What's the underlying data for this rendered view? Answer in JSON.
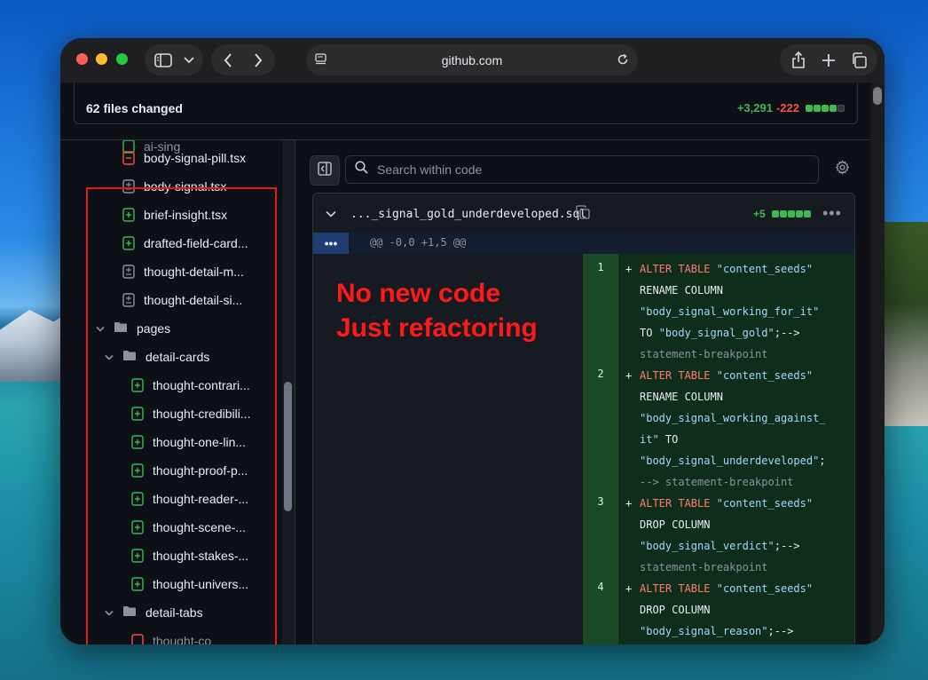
{
  "browser": {
    "url": "github.com"
  },
  "header": {
    "files_changed": "62 files changed",
    "additions": "+3,291",
    "deletions": "-222"
  },
  "tree": {
    "partial_top": "ai-sing",
    "items": [
      {
        "label": "body-signal-pill.tsx",
        "type": "file",
        "status": "removed"
      },
      {
        "label": "body-signal.tsx",
        "type": "file",
        "status": "modified"
      },
      {
        "label": "brief-insight.tsx",
        "type": "file",
        "status": "added"
      },
      {
        "label": "drafted-field-card...",
        "type": "file",
        "status": "added"
      },
      {
        "label": "thought-detail-m...",
        "type": "file",
        "status": "modified"
      },
      {
        "label": "thought-detail-si...",
        "type": "file",
        "status": "modified"
      },
      {
        "label": "pages",
        "type": "folder"
      },
      {
        "label": "detail-cards",
        "type": "folder"
      },
      {
        "label": "thought-contrari...",
        "type": "file",
        "status": "added"
      },
      {
        "label": "thought-credibili...",
        "type": "file",
        "status": "added"
      },
      {
        "label": "thought-one-lin...",
        "type": "file",
        "status": "added"
      },
      {
        "label": "thought-proof-p...",
        "type": "file",
        "status": "added"
      },
      {
        "label": "thought-reader-...",
        "type": "file",
        "status": "added"
      },
      {
        "label": "thought-scene-...",
        "type": "file",
        "status": "added"
      },
      {
        "label": "thought-stakes-...",
        "type": "file",
        "status": "added"
      },
      {
        "label": "thought-univers...",
        "type": "file",
        "status": "added"
      },
      {
        "label": "detail-tabs",
        "type": "folder"
      }
    ],
    "partial_bottom": "thought-co"
  },
  "search": {
    "placeholder": "Search within code"
  },
  "diff": {
    "filename": "..._signal_gold_underdeveloped.sql",
    "additions": "+5",
    "hunk_expand": "•••",
    "hunk_header": "@@ -0,0 +1,5 @@",
    "annotation_line1": "No new code",
    "annotation_line2": "Just refactoring",
    "lines": [
      {
        "num": "1",
        "sign": "+"
      },
      {
        "num": "2",
        "sign": "+"
      },
      {
        "num": "3",
        "sign": "+"
      },
      {
        "num": "4",
        "sign": "+"
      }
    ],
    "code": {
      "l1_kw": "ALTER TABLE",
      "l1_tbl": "\"content_seeds\"",
      "l1_rename": "RENAME COLUMN",
      "l1_old": "\"body_signal_working_for_it\"",
      "l1_to": "TO",
      "l1_new": "\"body_signal_gold\"",
      "l1_tail": ";-->",
      "l1_bp": "statement-breakpoint",
      "l2_kw": "ALTER TABLE",
      "l2_tbl": "\"content_seeds\"",
      "l2_rename": "RENAME COLUMN",
      "l2_old_a": "\"body_signal_working_against_",
      "l2_old_b": "it\"",
      "l2_to": "TO",
      "l2_new": "\"body_signal_underdeveloped\"",
      "l2_tail": ";",
      "l2_bp": "--> statement-breakpoint",
      "l3_kw": "ALTER TABLE",
      "l3_tbl": "\"content_seeds\"",
      "l3_drop": "DROP COLUMN",
      "l3_col": "\"body_signal_verdict\"",
      "l3_tail": ";-->",
      "l3_bp": "statement-breakpoint",
      "l4_kw": "ALTER TABLE",
      "l4_tbl": "\"content_seeds\"",
      "l4_drop": "DROP COLUMN",
      "l4_col": "\"body_signal_reason\"",
      "l4_tail": ";-->"
    }
  },
  "colors": {
    "added": "#3fb950",
    "removed": "#f85149",
    "annotation": "#ff1a1a",
    "highlight_box": "#e11c1c"
  }
}
